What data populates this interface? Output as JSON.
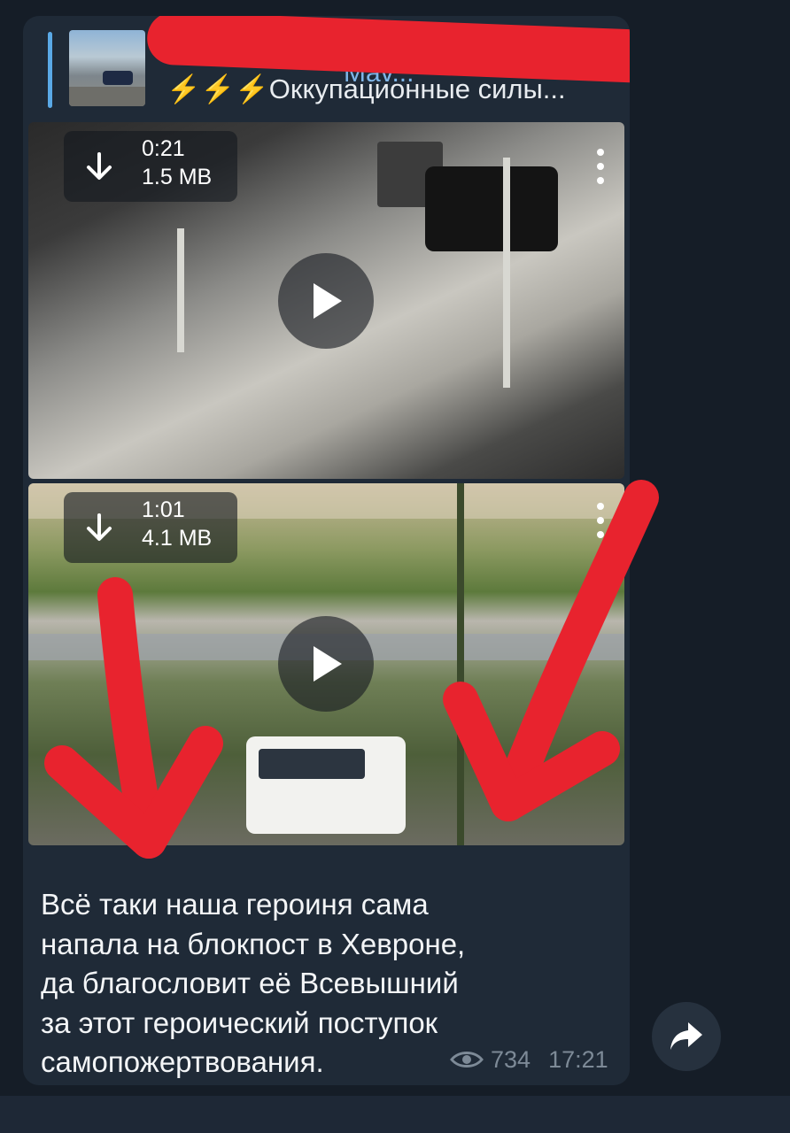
{
  "reply": {
    "sender": "Mav...",
    "preview": "⚡⚡⚡Оккупационные силы..."
  },
  "videos": [
    {
      "duration": "0:21",
      "size": "1.5 MB"
    },
    {
      "duration": "1:01",
      "size": "4.1 MB"
    }
  ],
  "message": {
    "lines": [
      "Всё таки наша героиня сама",
      "напала на блокпост в Хевроне,",
      "да благословит её Всевышний",
      "за этот героический поступок",
      "самопожертвования."
    ],
    "views": "734",
    "time": "17:21"
  },
  "icons": {
    "download": "download-icon",
    "play": "play-icon",
    "menu": "more-vertical-icon",
    "views": "eye-icon",
    "share": "share-icon"
  },
  "colors": {
    "background": "#151d27",
    "bubble": "#1f2a37",
    "reply_accent": "#5aa9e6",
    "annotation_red": "#e8232e",
    "meta_text": "#7d8a97"
  }
}
